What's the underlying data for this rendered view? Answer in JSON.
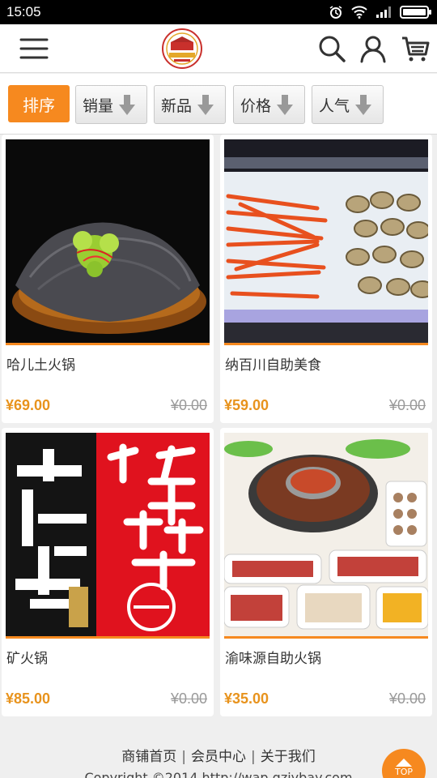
{
  "status_bar": {
    "time": "15:05"
  },
  "filters": {
    "sort_label": "排序",
    "items": [
      {
        "label": "销量"
      },
      {
        "label": "新品"
      },
      {
        "label": "价格"
      },
      {
        "label": "人气"
      }
    ]
  },
  "products": [
    {
      "name": "哈儿土火锅",
      "price": "¥69.00",
      "original_price": "¥0.00",
      "image": "tripe-hotpot-dish"
    },
    {
      "name": "纳百川自助美食",
      "price": "¥59.00",
      "original_price": "¥0.00",
      "image": "seafood-buffet"
    },
    {
      "name": "矿火锅",
      "price": "¥85.00",
      "original_price": "¥0.00",
      "image": "hotpot-poster"
    },
    {
      "name": "渝味源自助火锅",
      "price": "¥35.00",
      "original_price": "¥0.00",
      "image": "hotpot-table-spread"
    }
  ],
  "footer": {
    "links": [
      "商铺首页",
      "会员中心",
      "关于我们"
    ],
    "copyright": "Copyright ©2014 http://wap.qzjybay.com"
  },
  "top_button": {
    "label": "TOP"
  },
  "colors": {
    "accent": "#f6891f",
    "price": "#e8931d"
  },
  "icons": [
    "menu-icon",
    "search-icon",
    "user-icon",
    "cart-icon",
    "down-arrow-icon"
  ]
}
